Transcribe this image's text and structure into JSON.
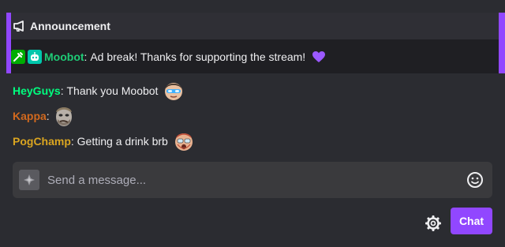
{
  "announcement": {
    "title": "Announcement",
    "icon": "megaphone-icon",
    "message": {
      "badges": [
        "moderator-badge-icon",
        "bot-badge-icon"
      ],
      "username": "Moobot",
      "separator": ":",
      "text": "Ad break! Thanks for supporting the stream!",
      "trailing_emoji": "purple-heart-icon",
      "username_color": "#1ecb76"
    },
    "accent_color": "#9147ff"
  },
  "messages": [
    {
      "username": "HeyGuys",
      "separator": ":",
      "text": "Thank you Moobot",
      "username_color": "#00ff7f",
      "emote": "heyguys-emote"
    },
    {
      "username": "Kappa",
      "separator": ":",
      "text": "",
      "username_color": "#d2691e",
      "emote": "kappa-emote"
    },
    {
      "username": "PogChamp",
      "separator": ":",
      "text": "Getting a drink brb",
      "username_color": "#daa520",
      "emote": "pogchamp-emote"
    }
  ],
  "chat_input": {
    "placeholder": "Send a message...",
    "left_icon": "bits-icon",
    "right_icon": "emoji-icon"
  },
  "footer": {
    "settings_icon": "gear-icon",
    "chat_button_label": "Chat",
    "chat_button_color": "#9147ff"
  }
}
